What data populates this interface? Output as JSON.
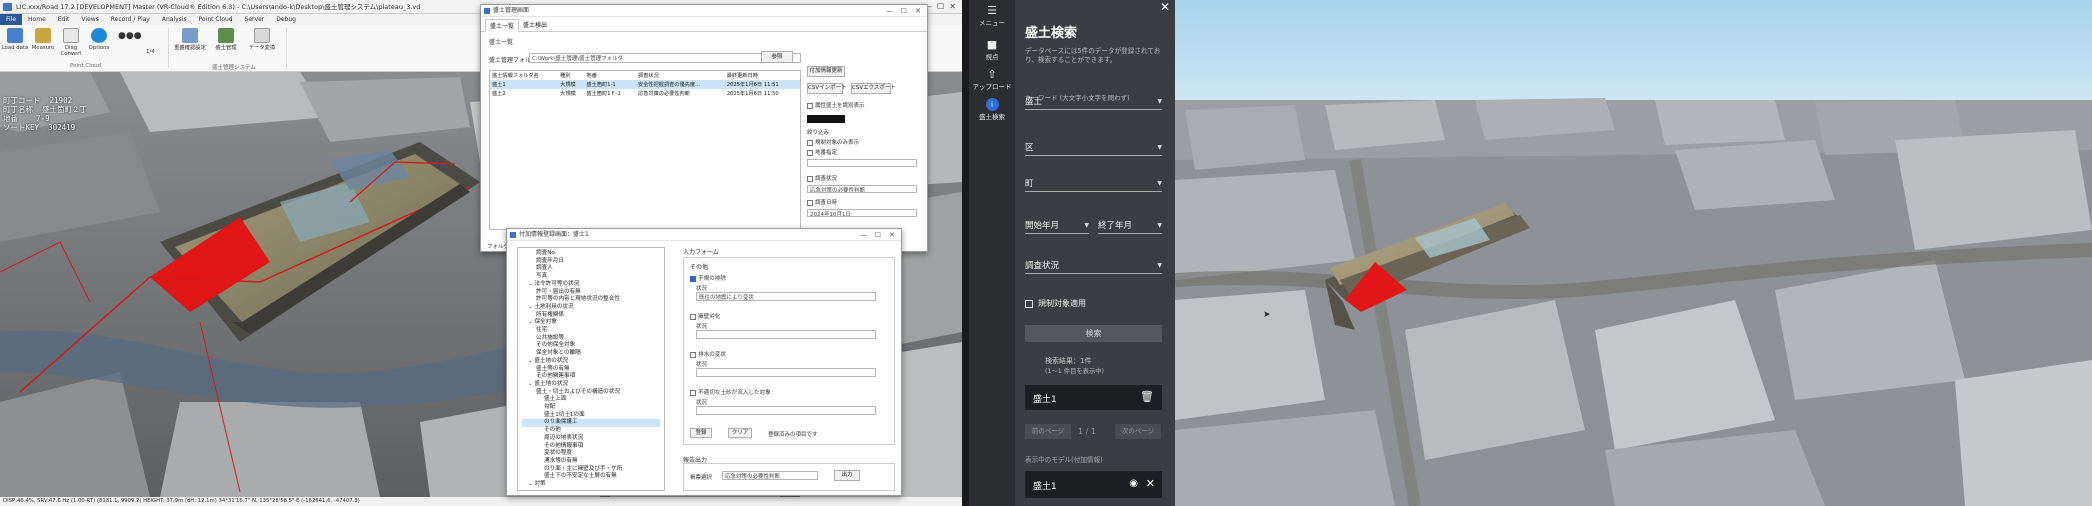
{
  "desktop": {
    "title": "LIC.xxx/Road 17.2 [DEVELOPMENT] Master (VR-Cloud® Edition 6.3) - C:\\Users\\ando-k\\Desktop\\盛土管理システム\\plateau_3.vd",
    "menu": [
      "File",
      "Home",
      "Edit",
      "Views",
      "Record / Play",
      "Analysis",
      "Point Cloud",
      "Server",
      "Debug"
    ],
    "ribbon": {
      "buttons": [
        "Load data",
        "Measure",
        "Diag Convert",
        "Options"
      ],
      "group1_label": "Point Cloud",
      "buttons2": [
        "重盛確認設定",
        "盛土管理",
        "データ変換"
      ],
      "group2_label": "盛土管理システム",
      "zoom_value": "1/4"
    },
    "overlay": [
      "町丁コード  21902",
      "町丁名称  盛土箇町２丁",
      "地番    7-9",
      "ソートKEY  302419"
    ],
    "status": "DISP:46.4%, SRV:47.6 Hz (1.00-RT)                                  (8181.1, 9909.2)  HEIGHT: 37.9m (dH: 12.1m)          34°31'16.7\" N, 135°28'58.5\" E    (-162641.6, -47407.3)",
    "dialog1": {
      "title": "盛土管理画面",
      "tabs": [
        "盛土一覧",
        "盛土検出"
      ],
      "section": "盛土一覧",
      "folder_label": "盛土管理フォルダ",
      "folder_path": "C:\\Work\\盛土管理\\盛土管理フォルダ",
      "ref_button": "参照",
      "columns": [
        "盛土情報フォルダ名",
        "種別",
        "地番",
        "調査状況",
        "最終更新日時"
      ],
      "rows": [
        [
          "盛土1",
          "大規模",
          "盛土箇町1-1",
          "安全性把握調査の優先度...",
          "2025年1月6日 11:51"
        ],
        [
          "盛土2",
          "大規模",
          "盛土箇町1Ｆ-1",
          "応急対策の必要性判断",
          "2025年1月6日 11:50"
        ]
      ],
      "right_buttons": [
        "付加情報更新",
        "CSVインポート",
        "CSVエクスポート"
      ],
      "opt_show_colored": "属性盛土を識別表示",
      "opt_filter": "絞り込み",
      "opt_inactive": "規制対象のみ表示",
      "opt_area": "地番指定",
      "opt_status": "調査状況",
      "status_value": "応急対策の必要性判断",
      "opt_date": "調査日時",
      "date_value": "2024年10月1日",
      "bottom": [
        "時期",
        "フォルダ"
      ]
    },
    "dialog2": {
      "title": "付加情報登録画面：盛土1",
      "tree": [
        "調査No.",
        "調査年月日",
        "調査人",
        "写真",
        "法令許可等の状況",
        "許可・届出の有無",
        "許可等の内容と現地状況の整合性",
        "土地利用の状況",
        "所有権関係",
        "保全対象",
        "住宅",
        "公共施設等",
        "その他保全対象",
        "保全対象との離隔",
        "盛土地の状況",
        "盛土等の有無",
        "その他関連事項",
        "盛土地の状況",
        "盛土・切土およびその構造の状況",
        "盛土上面",
        "勾配",
        "盛土1切土1の面",
        "のり面保護工",
        "その他",
        "周辺の地表状況",
        "その他情報事項",
        "変状の程度",
        "湧水等の有無",
        "のり面・主に擁壁及び手・ケ所",
        "盛土下の不安定な土層の有無",
        "対策"
      ],
      "input_form_label": "入力フォーム",
      "form_title": "その他",
      "checks": [
        {
          "label": "不規の排除",
          "checked": true,
          "sub": "状況",
          "value": "既往の地震により変状"
        },
        {
          "label": "擁壁劣化",
          "checked": false,
          "sub": "状況",
          "value": ""
        },
        {
          "label": "排水の変状",
          "checked": false,
          "sub": "状況",
          "value": ""
        },
        {
          "label": "不適切な土砂が流入した対象",
          "checked": false,
          "sub": "状況",
          "value": ""
        }
      ],
      "buttons": [
        "登録",
        "クリア",
        "登録済みの項目です"
      ],
      "report_label": "報告出力",
      "report_select_label": "帳票選択",
      "report_value": "応急対策の必要性判断",
      "report_button": "出力"
    }
  },
  "web": {
    "sidebar": [
      {
        "icon": "☰",
        "label": "メニュー"
      },
      {
        "icon": "■",
        "label": "視点"
      },
      {
        "icon": "⇧",
        "label": "アップロード"
      },
      {
        "icon": "i",
        "label": "盛土検索"
      }
    ],
    "panel": {
      "title": "盛土検索",
      "description": "データベースには5件のデータが登録されており、検索することができます。",
      "keyword_label": "キーワード (大文字小文字を問わず)",
      "keyword_value": "盛土",
      "ward_label": "区",
      "town_label": "町",
      "start_label": "開始年月",
      "end_label": "終了年月",
      "status_label": "調査状況",
      "regulated_label": "規制対象適用",
      "search_button": "検索",
      "result_label": "検索結果：1件",
      "result_sub": "(1～1 件目を表示中)",
      "result_item": "盛土1",
      "prev_label": "前のページ",
      "page_label": "1 / 1",
      "next_label": "次のページ",
      "displayed_label": "表示中のモデル(付加情報)",
      "displayed_item": "盛土1"
    }
  }
}
